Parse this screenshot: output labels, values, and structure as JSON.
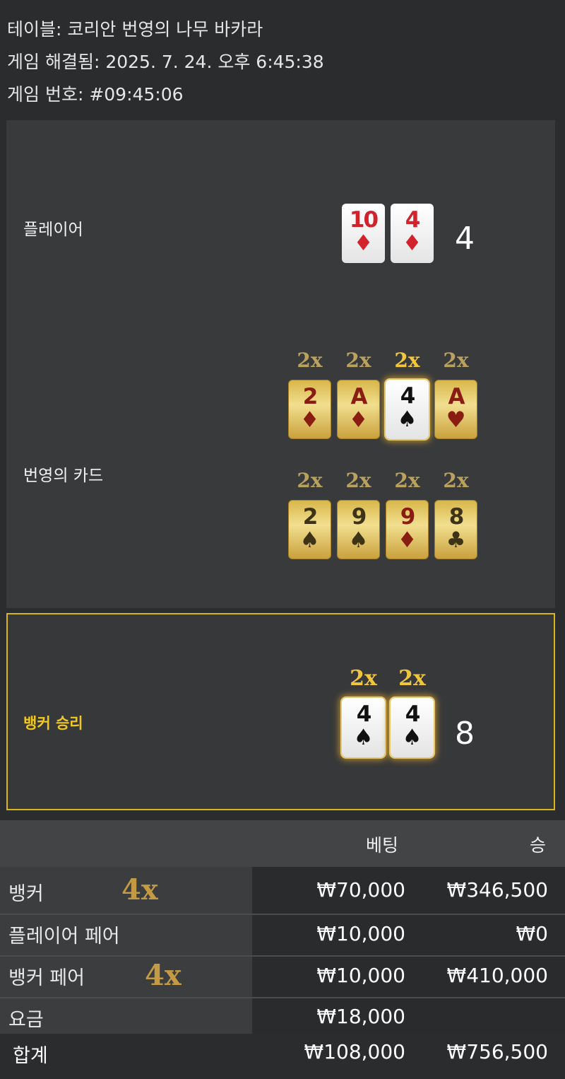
{
  "header": {
    "table_line": "테이블: 코리안 번영의 나무 바카라",
    "resolved_line": "게임 해결됨: 2025. 7. 24. 오후 6:45:38",
    "game_number_line": "게임 번호: #09:45:06"
  },
  "player": {
    "label": "플레이어",
    "score": "4",
    "cards": [
      {
        "rank": "10",
        "suit": "♦"
      },
      {
        "rank": "4",
        "suit": "♦"
      }
    ]
  },
  "prosperity": {
    "label": "번영의 카드",
    "row1": [
      {
        "mult": "2x",
        "rank": "2",
        "suit": "♦"
      },
      {
        "mult": "2x",
        "rank": "A",
        "suit": "♦"
      },
      {
        "mult": "2x",
        "rank": "4",
        "suit": "♠"
      },
      {
        "mult": "2x",
        "rank": "A",
        "suit": "♥"
      }
    ],
    "row2": [
      {
        "mult": "2x",
        "rank": "2",
        "suit": "♠"
      },
      {
        "mult": "2x",
        "rank": "9",
        "suit": "♠"
      },
      {
        "mult": "2x",
        "rank": "9",
        "suit": "♦"
      },
      {
        "mult": "2x",
        "rank": "8",
        "suit": "♣"
      }
    ]
  },
  "banker": {
    "label": "뱅커 승리",
    "score": "8",
    "cards": [
      {
        "mult": "2x",
        "rank": "4",
        "suit": "♠"
      },
      {
        "mult": "2x",
        "rank": "4",
        "suit": "♠"
      }
    ]
  },
  "bets_table": {
    "bet_header": "베팅",
    "win_header": "승",
    "rows": [
      {
        "label": "뱅커",
        "mult": "4x",
        "bet": "₩70,000",
        "win": "₩346,500"
      },
      {
        "label": "플레이어 페어",
        "mult": "",
        "bet": "₩10,000",
        "win": "₩0"
      },
      {
        "label": "뱅커 페어",
        "mult": "4x",
        "bet": "₩10,000",
        "win": "₩410,000"
      },
      {
        "label": "요금",
        "mult": "",
        "bet": "₩18,000",
        "win": ""
      }
    ],
    "total": {
      "label": "합계",
      "bet": "₩108,000",
      "win": "₩756,500"
    }
  },
  "colors": {
    "background": "#2b2c2e",
    "highlight_border": "#d8b61a",
    "winner_text": "#f2c81e",
    "multiplier_gold": "#c49b44"
  }
}
